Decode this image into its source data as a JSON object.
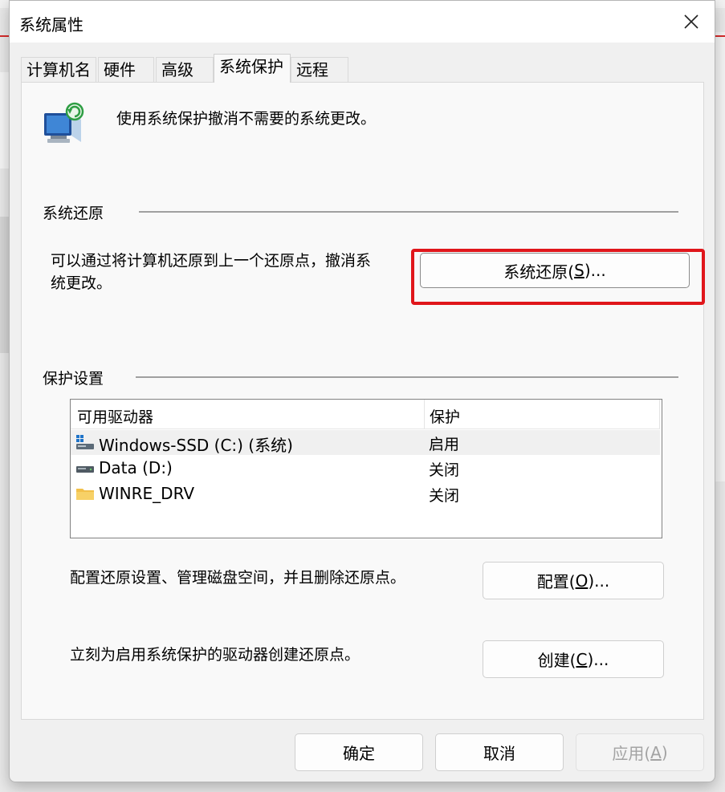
{
  "window": {
    "title": "系统属性"
  },
  "tabs": [
    {
      "label": "计算机名"
    },
    {
      "label": "硬件"
    },
    {
      "label": "高级"
    },
    {
      "label": "系统保护"
    },
    {
      "label": "远程"
    }
  ],
  "intro": "使用系统保护撤消不需要的系统更改。",
  "restore": {
    "section_title": "系统还原",
    "description_line1": "可以通过将计算机还原到上一个还原点，撤消系",
    "description_line2": "统更改。",
    "button_pre": "系统还原(",
    "button_key": "S",
    "button_post": ")..."
  },
  "protection": {
    "section_title": "保护设置",
    "columns": [
      "可用驱动器",
      "保护"
    ],
    "drives": [
      {
        "name": "Windows-SSD (C:) (系统)",
        "protection": "启用",
        "icon": "system-drive-icon"
      },
      {
        "name": "Data (D:)",
        "protection": "关闭",
        "icon": "drive-icon"
      },
      {
        "name": "WINRE_DRV",
        "protection": "关闭",
        "icon": "folder-icon"
      }
    ],
    "config_desc": "配置还原设置、管理磁盘空间，并且删除还原点。",
    "config_pre": "配置(",
    "config_key": "O",
    "config_post": ")...",
    "create_desc": "立刻为启用系统保护的驱动器创建还原点。",
    "create_pre": "创建(",
    "create_key": "C",
    "create_post": ")..."
  },
  "footer": {
    "ok": "确定",
    "cancel": "取消",
    "apply_pre": "应用(",
    "apply_key": "A",
    "apply_post": ")"
  },
  "colors": {
    "highlight": "#e0161b",
    "dialog_bg": "#f0f0f0",
    "panel_bg": "#f9f9f9"
  }
}
